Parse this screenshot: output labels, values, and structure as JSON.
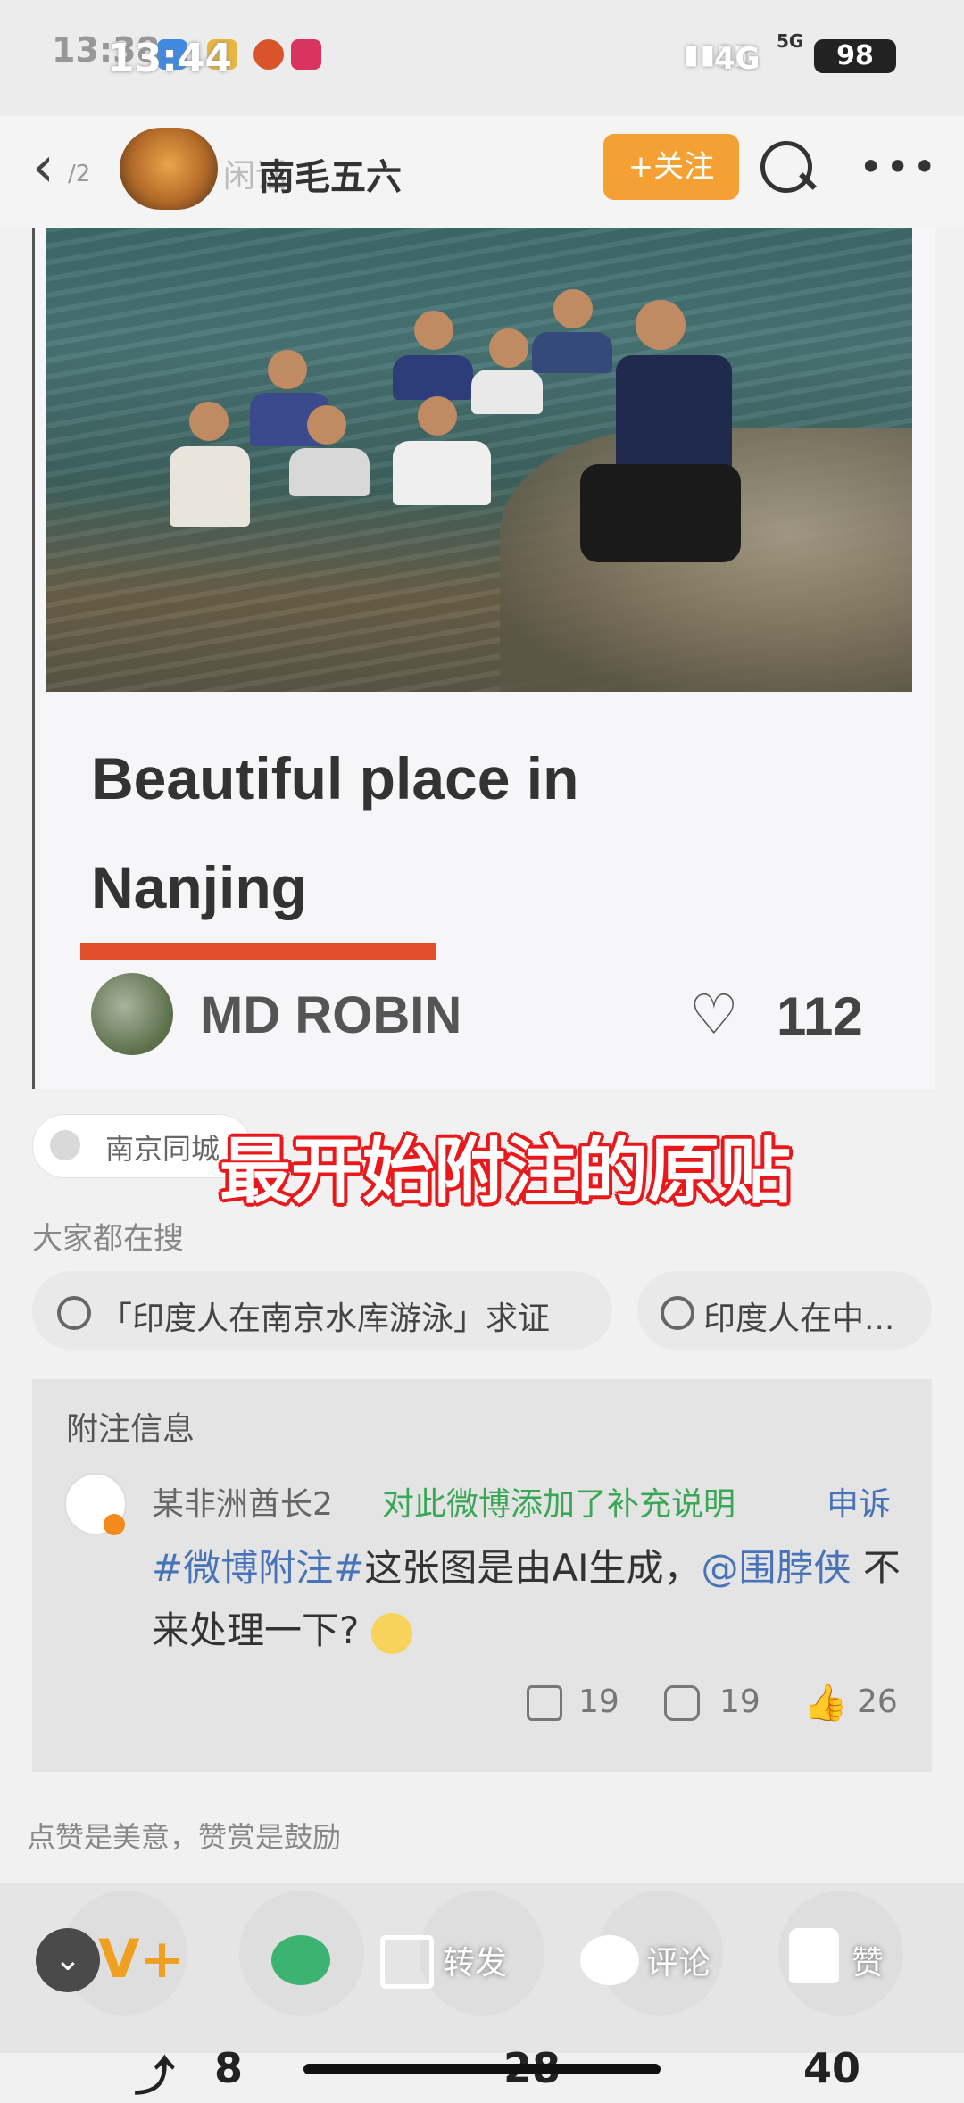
{
  "status_bar": {
    "time_back": "13:38",
    "time_front": "13:44",
    "network": "4G",
    "network_small": "5G",
    "battery": "98"
  },
  "header": {
    "page_indicator": "/2",
    "username_ghost": "闲话",
    "username": "南毛五六",
    "follow_label": "+关注"
  },
  "post": {
    "title_line1": "Beautiful place in",
    "title_line2": "Nanjing",
    "author": "MD ROBIN",
    "likes": "112"
  },
  "location_tag": "南京同城",
  "overlay_caption": "最开始附注的原贴",
  "search": {
    "label": "大家都在搜",
    "chips": [
      "「印度人在南京水库游泳」求证",
      "印度人在中..."
    ]
  },
  "annotation": {
    "title": "附注信息",
    "user": "某非洲酋长2",
    "action": "对此微博添加了补充说明",
    "appeal": "申诉",
    "hashtag": "#微博附注#",
    "body_text": "这张图是由AI生成，",
    "mention": "@围脖侠",
    "body_end": " 不来处理一下?",
    "reposts": "19",
    "comments": "19",
    "likes": "26"
  },
  "footer_note": "点赞是美意，赞赏是鼓励",
  "action_bar": {
    "repost_label": "转发",
    "comment_label": "评论",
    "like_label": "赞"
  },
  "underlay_counts": {
    "reposts": "8",
    "comments": "28",
    "likes": "40"
  }
}
